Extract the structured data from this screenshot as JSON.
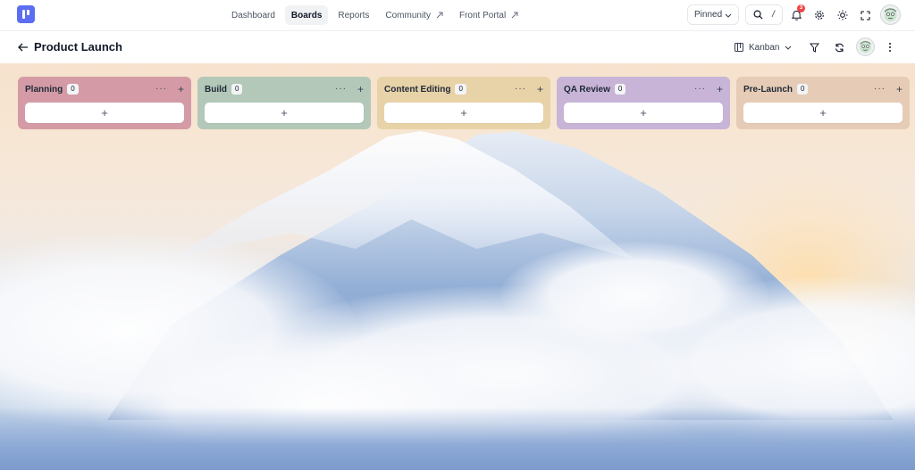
{
  "nav": {
    "items": [
      {
        "label": "Dashboard",
        "active": false,
        "external": false
      },
      {
        "label": "Boards",
        "active": true,
        "external": false
      },
      {
        "label": "Reports",
        "active": false,
        "external": false
      },
      {
        "label": "Community",
        "active": false,
        "external": true
      },
      {
        "label": "Front Portal",
        "active": false,
        "external": true
      }
    ],
    "pinned_label": "Pinned",
    "search_shortcut": "/",
    "notification_count": "3"
  },
  "board": {
    "title": "Product Launch",
    "view_label": "Kanban",
    "columns": [
      {
        "title": "Planning",
        "count": "0",
        "color": "#d49ba6"
      },
      {
        "title": "Build",
        "count": "0",
        "color": "#b3c8b8"
      },
      {
        "title": "Content Editing",
        "count": "0",
        "color": "#e8d2a8"
      },
      {
        "title": "QA Review",
        "count": "0",
        "color": "#c7b4d6"
      },
      {
        "title": "Pre-Launch",
        "count": "0",
        "color": "#e6ccb6"
      }
    ],
    "add_symbol": "+",
    "more_symbol": "···"
  },
  "colors": {
    "accent": "#5b6ef1",
    "badge": "#ef4444"
  },
  "icons": [
    "logo-icon",
    "external-link-icon",
    "chevron-down-icon",
    "search-icon",
    "bell-icon",
    "gear-icon",
    "sun-icon",
    "fullscreen-icon",
    "back-arrow-icon",
    "kanban-icon",
    "filter-icon",
    "refresh-icon",
    "more-vertical-icon",
    "plus-icon",
    "ellipsis-icon"
  ]
}
